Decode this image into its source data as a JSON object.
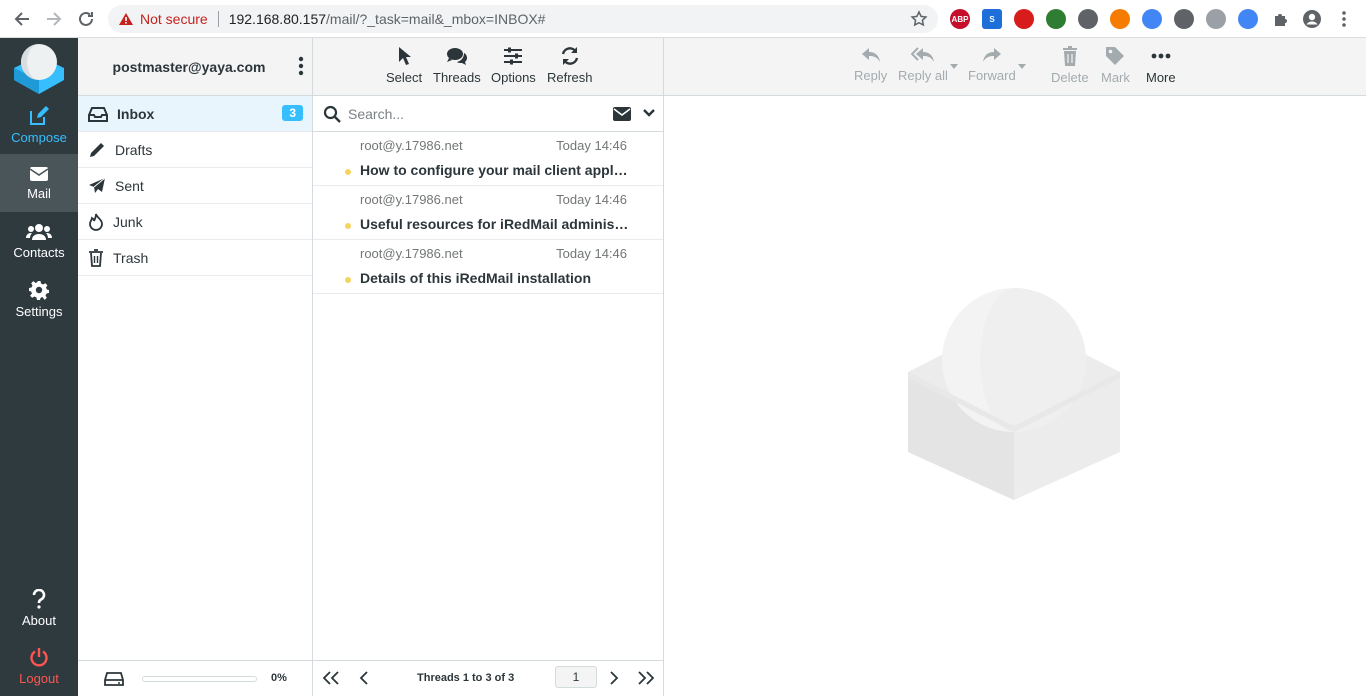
{
  "browser": {
    "security_label": "Not secure",
    "url_host": "192.168.80.157",
    "url_path": "/mail/?_task=mail&_mbox=INBOX#",
    "extensions": [
      {
        "label": "ABP",
        "color": "#c70d2c"
      },
      {
        "label": "S",
        "color": "#1e6fd9"
      },
      {
        "label": "",
        "color": "#d81b1b"
      },
      {
        "label": "",
        "color": "#2e7d32"
      },
      {
        "label": "",
        "color": "#5f6368"
      },
      {
        "label": "",
        "color": "#f57c00"
      },
      {
        "label": "",
        "color": "#4285f4"
      },
      {
        "label": "",
        "color": "#5f6368"
      },
      {
        "label": "",
        "color": "#9aa0a6"
      },
      {
        "label": "",
        "color": "#4285f4"
      }
    ]
  },
  "taskbar": {
    "compose": "Compose",
    "mail": "Mail",
    "contacts": "Contacts",
    "settings": "Settings",
    "about": "About",
    "logout": "Logout"
  },
  "folders_pane": {
    "account": "postmaster@yaya.com",
    "items": [
      {
        "label": "Inbox",
        "unread": "3",
        "icon": "inbox-icon"
      },
      {
        "label": "Drafts",
        "icon": "pencil-icon"
      },
      {
        "label": "Sent",
        "icon": "paper-plane-icon"
      },
      {
        "label": "Junk",
        "icon": "fire-icon"
      },
      {
        "label": "Trash",
        "icon": "trash-icon"
      }
    ],
    "quota_text": "0%",
    "quota_used_fraction": 0.0
  },
  "list_toolbar": {
    "select": "Select",
    "threads": "Threads",
    "options": "Options",
    "refresh": "Refresh"
  },
  "search": {
    "placeholder": "Search..."
  },
  "messages": [
    {
      "from": "root@y.17986.net",
      "date": "Today 14:46",
      "subject": "How to configure your mail client applications"
    },
    {
      "from": "root@y.17986.net",
      "date": "Today 14:46",
      "subject": "Useful resources for iRedMail administrators"
    },
    {
      "from": "root@y.17986.net",
      "date": "Today 14:46",
      "subject": "Details of this iRedMail installation"
    }
  ],
  "pager": {
    "count_text": "Threads 1 to 3 of 3",
    "page": "1"
  },
  "message_toolbar": {
    "reply": "Reply",
    "reply_all": "Reply all",
    "forward": "Forward",
    "delete": "Delete",
    "mark": "Mark",
    "more": "More"
  },
  "colors": {
    "accent": "#37beff",
    "taskbar_bg": "#2f3a3f",
    "logout": "#ff5552",
    "unread_dot": "#f4d35e"
  }
}
